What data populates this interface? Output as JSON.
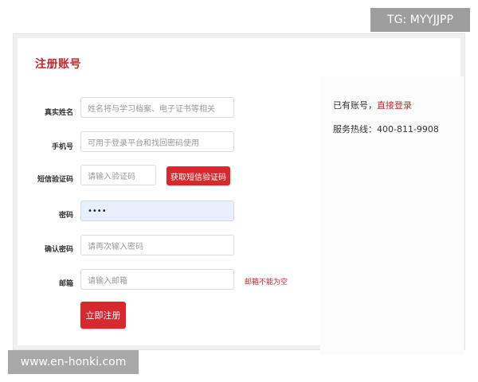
{
  "watermarks": {
    "top": "TG: MYYJJPP",
    "bottom": "www.en-honki.com"
  },
  "form": {
    "title": "注册账号",
    "fields": [
      {
        "label": "真实姓名",
        "placeholder": "姓名将与学习档案、电子证书等相关",
        "value": ""
      },
      {
        "label": "手机号",
        "placeholder": "可用于登录平台和找回密码使用",
        "value": ""
      },
      {
        "label": "短信验证码",
        "placeholder": "请输入验证码",
        "value": ""
      },
      {
        "label": "密码",
        "placeholder": "",
        "value": "••••"
      },
      {
        "label": "确认密码",
        "placeholder": "请再次输入密码",
        "value": ""
      },
      {
        "label": "邮箱",
        "placeholder": "请输入邮箱",
        "value": ""
      }
    ],
    "get_code_button": "获取短信验证码",
    "email_hint": "邮箱不能为空",
    "submit_button": "立即注册"
  },
  "side": {
    "has_account_text": "已有账号，",
    "login_link": "直接登录",
    "hotline_label": "服务热线：",
    "hotline_number": "400-811-9908"
  },
  "colors": {
    "accent": "#d7282d",
    "focused_field": "#e8f0fe"
  }
}
